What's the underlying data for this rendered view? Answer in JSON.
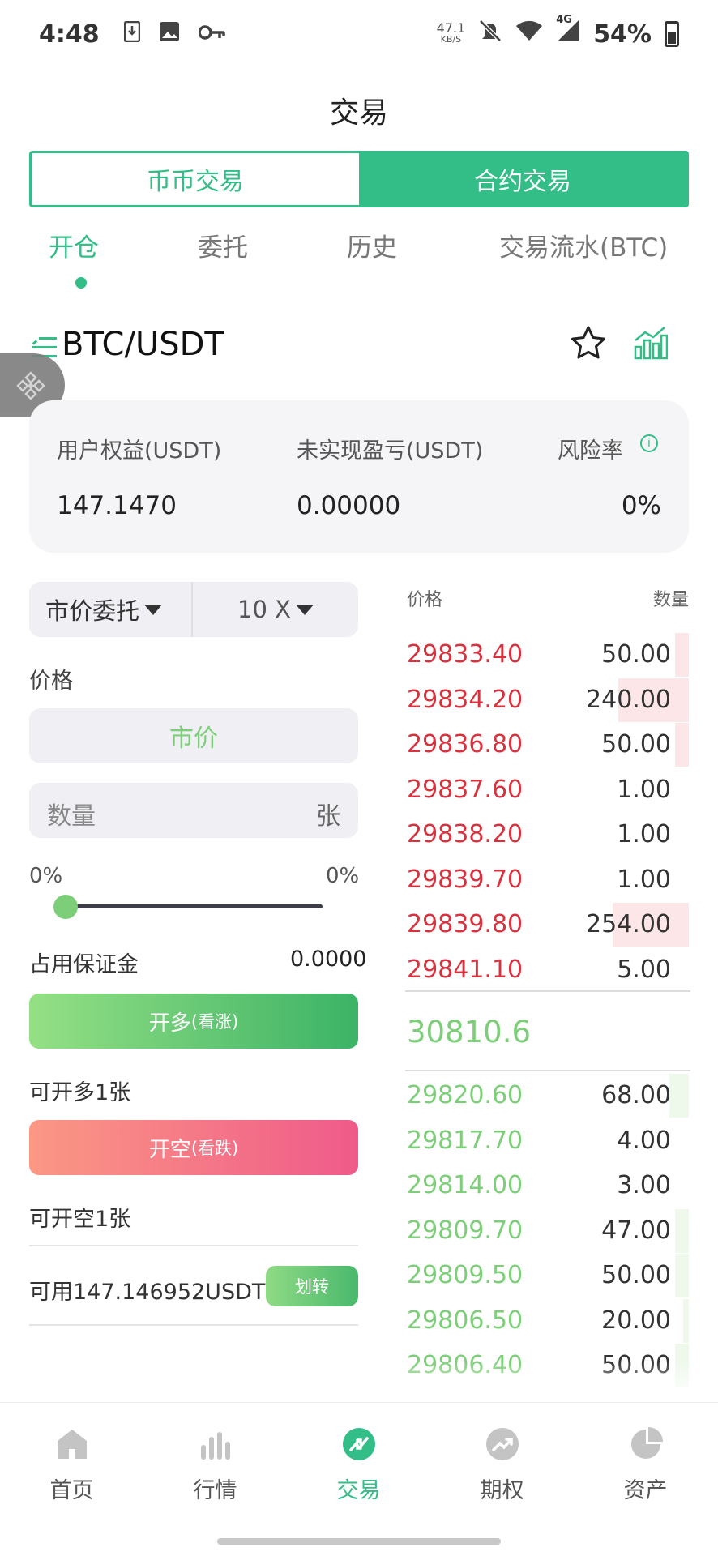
{
  "status_bar": {
    "time": "4:48",
    "net_speed_value": "47.1",
    "net_speed_unit": "KB/S",
    "network": "4G",
    "battery": "54%"
  },
  "page_title": "交易",
  "segment": {
    "spot": "币币交易",
    "futures": "合约交易",
    "selected": "合约交易"
  },
  "tabs": [
    {
      "label": "开仓",
      "active": true
    },
    {
      "label": "委托",
      "active": false
    },
    {
      "label": "历史",
      "active": false
    },
    {
      "label": "交易流水(BTC)",
      "active": false
    }
  ],
  "pair": {
    "symbol": "BTC/USDT"
  },
  "account": {
    "equity_label": "用户权益(USDT)",
    "equity_value": "147.1470",
    "unrealized_label": "未实现盈亏(USDT)",
    "unrealized_value": "0.00000",
    "risk_label": "风险率",
    "risk_value": "0%"
  },
  "order_form": {
    "order_type": "市价委托",
    "leverage": "10 X",
    "price_label": "价格",
    "price_value": "市价",
    "quantity_placeholder": "数量",
    "quantity_unit": "张",
    "slider_min_label": "0%",
    "slider_max_label": "0%",
    "slider_value_percent": 0,
    "margin_label": "占用保证金",
    "margin_value": "0.0000",
    "long_button": "开多",
    "long_button_sub": "(看涨)",
    "can_open_long": "可开多1张",
    "short_button": "开空",
    "short_button_sub": "(看跌)",
    "can_open_short": "可开空1张",
    "available": "可用147.146952USDT",
    "transfer_button": "划转"
  },
  "order_book": {
    "price_header": "价格",
    "qty_header": "数量",
    "asks": [
      {
        "price": "29833.40",
        "qty": "50.00",
        "depth": 0.05
      },
      {
        "price": "29834.20",
        "qty": "240.00",
        "depth": 0.25
      },
      {
        "price": "29836.80",
        "qty": "50.00",
        "depth": 0.05
      },
      {
        "price": "29837.60",
        "qty": "1.00",
        "depth": 0
      },
      {
        "price": "29838.20",
        "qty": "1.00",
        "depth": 0
      },
      {
        "price": "29839.70",
        "qty": "1.00",
        "depth": 0
      },
      {
        "price": "29839.80",
        "qty": "254.00",
        "depth": 0.27
      },
      {
        "price": "29841.10",
        "qty": "5.00",
        "depth": 0
      }
    ],
    "last_price": "30810.6",
    "bids": [
      {
        "price": "29820.60",
        "qty": "68.00",
        "depth": 0.07
      },
      {
        "price": "29817.70",
        "qty": "4.00",
        "depth": 0
      },
      {
        "price": "29814.00",
        "qty": "3.00",
        "depth": 0
      },
      {
        "price": "29809.70",
        "qty": "47.00",
        "depth": 0.05
      },
      {
        "price": "29809.50",
        "qty": "50.00",
        "depth": 0.05
      },
      {
        "price": "29806.50",
        "qty": "20.00",
        "depth": 0.02
      },
      {
        "price": "29806.40",
        "qty": "50.00",
        "depth": 0.05
      }
    ]
  },
  "colors": {
    "accent": "#33bd87",
    "ask": "#d9323f",
    "bid": "#7dce78",
    "long_gradient": [
      "#95e085",
      "#3cb366"
    ],
    "short_gradient": [
      "#fb9884",
      "#ef5a8a"
    ]
  },
  "nav": [
    {
      "label": "首页",
      "icon": "home-icon",
      "active": false
    },
    {
      "label": "行情",
      "icon": "market-bars-icon",
      "active": false
    },
    {
      "label": "交易",
      "icon": "trade-icon",
      "active": true
    },
    {
      "label": "期权",
      "icon": "options-trend-icon",
      "active": false
    },
    {
      "label": "资产",
      "icon": "assets-pie-icon",
      "active": false
    }
  ]
}
